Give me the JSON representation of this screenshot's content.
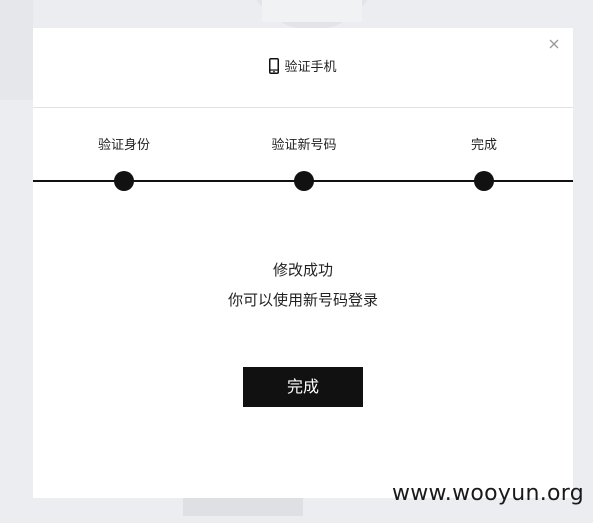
{
  "modal": {
    "title": "验证手机",
    "title_icon": "mobile-phone-icon",
    "close_icon": "close-icon"
  },
  "steps": {
    "items": [
      {
        "label": "验证身份"
      },
      {
        "label": "验证新号码"
      },
      {
        "label": "完成"
      }
    ],
    "current_step": 3
  },
  "message": {
    "line1": "修改成功",
    "line2": "你可以使用新号码登录"
  },
  "actions": {
    "done_label": "完成"
  },
  "watermark": {
    "text": "www.wooyun.org"
  },
  "colors": {
    "accent": "#111111",
    "backdrop": "#ecedf1",
    "modal_bg": "#ffffff"
  }
}
